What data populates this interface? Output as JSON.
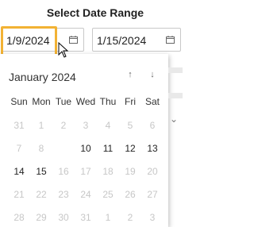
{
  "dialog": {
    "title": "Select Date Range"
  },
  "start_date": {
    "value": "1/9/2024",
    "icon": "calendar-icon"
  },
  "end_date": {
    "value": "1/15/2024",
    "icon": "calendar-icon"
  },
  "calendar": {
    "month_label": "January 2024",
    "prev_icon": "arrow-up-icon",
    "next_icon": "arrow-down-icon",
    "weekdays": [
      "Sun",
      "Mon",
      "Tue",
      "Wed",
      "Thu",
      "Fri",
      "Sat"
    ],
    "weeks": [
      [
        {
          "label": "31",
          "muted": true
        },
        {
          "label": "1",
          "muted": true
        },
        {
          "label": "2",
          "muted": true
        },
        {
          "label": "3",
          "muted": true
        },
        {
          "label": "4",
          "muted": true
        },
        {
          "label": "5",
          "muted": true
        },
        {
          "label": "6",
          "muted": true
        }
      ],
      [
        {
          "label": "7",
          "muted": true
        },
        {
          "label": "8",
          "muted": true
        },
        {
          "label": "9",
          "muted": false,
          "selected": true
        },
        {
          "label": "10",
          "muted": false
        },
        {
          "label": "11",
          "muted": false
        },
        {
          "label": "12",
          "muted": false
        },
        {
          "label": "13",
          "muted": false
        }
      ],
      [
        {
          "label": "14",
          "muted": false
        },
        {
          "label": "15",
          "muted": false
        },
        {
          "label": "16",
          "muted": true
        },
        {
          "label": "17",
          "muted": true
        },
        {
          "label": "18",
          "muted": true
        },
        {
          "label": "19",
          "muted": true
        },
        {
          "label": "20",
          "muted": true
        }
      ],
      [
        {
          "label": "21",
          "muted": true
        },
        {
          "label": "22",
          "muted": true
        },
        {
          "label": "23",
          "muted": true
        },
        {
          "label": "24",
          "muted": true
        },
        {
          "label": "25",
          "muted": true
        },
        {
          "label": "26",
          "muted": true
        },
        {
          "label": "27",
          "muted": true
        }
      ],
      [
        {
          "label": "28",
          "muted": true
        },
        {
          "label": "29",
          "muted": true
        },
        {
          "label": "30",
          "muted": true
        },
        {
          "label": "31",
          "muted": true
        },
        {
          "label": "1",
          "muted": true
        },
        {
          "label": "2",
          "muted": true
        },
        {
          "label": "3",
          "muted": true
        }
      ]
    ]
  },
  "colors": {
    "focus_ring": "#f2b234",
    "selected_day_bg": "#2f2f2f",
    "muted_day_text": "#c7c7c7"
  }
}
